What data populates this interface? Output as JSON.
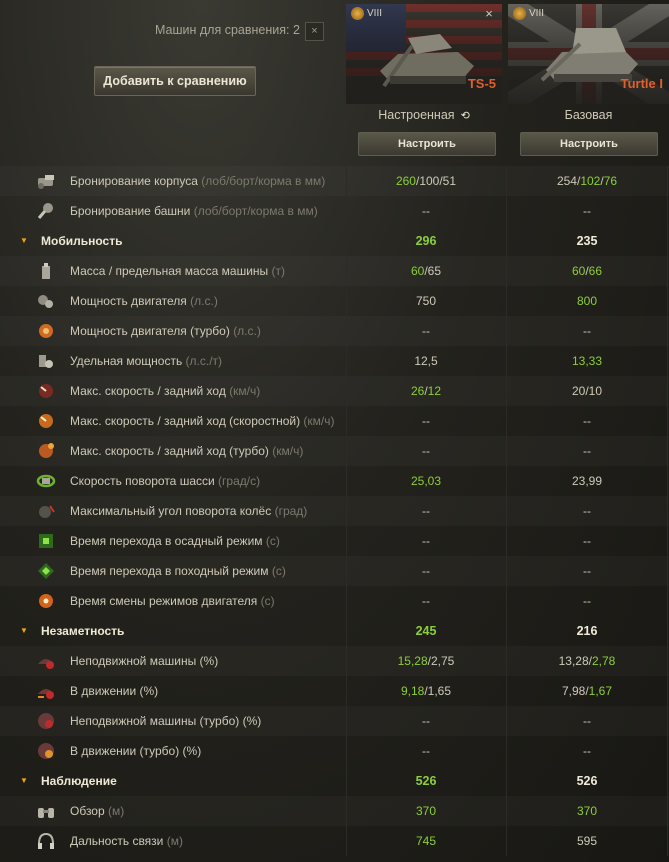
{
  "header": {
    "compare_label": "Машин для сравнения: 2",
    "close_symbol": "×",
    "add_button": "Добавить к сравнению"
  },
  "vehicles": [
    {
      "tier": "VIII",
      "name": "TS-5",
      "config": "Настроенная",
      "configure_button": "Настроить",
      "flag": "usa",
      "has_reset": true
    },
    {
      "tier": "VIII",
      "name": "Turtle I",
      "config": "Базовая",
      "configure_button": "Настроить",
      "flag": "uk",
      "has_reset": false
    }
  ],
  "accent_colors": {
    "green": "#8bcf3a",
    "orange": "#f0a21a",
    "name_red": "#e25f2b"
  },
  "rows": [
    {
      "type": "stat",
      "icon": "hull-armor-icon",
      "label": "Бронирование корпуса",
      "unit": "(лоб/борт/корма в мм)",
      "v1": [
        {
          "t": "260",
          "g": true
        },
        {
          "t": "/100/51",
          "g": false
        }
      ],
      "v2": [
        {
          "t": "254/",
          "g": false
        },
        {
          "t": "102",
          "g": true
        },
        {
          "t": "/",
          "g": false
        },
        {
          "t": "76",
          "g": true
        }
      ]
    },
    {
      "type": "stat",
      "icon": "turret-armor-icon",
      "label": "Бронирование башни",
      "unit": "(лоб/борт/корма в мм)",
      "v1": [
        {
          "t": "--",
          "g": false
        }
      ],
      "v2": [
        {
          "t": "--",
          "g": false
        }
      ]
    },
    {
      "type": "group",
      "label": "Мобильность",
      "v1": "296",
      "v2": "235"
    },
    {
      "type": "stat",
      "icon": "weight-icon",
      "label": "Масса / предельная масса машины",
      "unit": "(т)",
      "v1": [
        {
          "t": "60",
          "g": true
        },
        {
          "t": "/65",
          "g": false
        }
      ],
      "v2": [
        {
          "t": "60",
          "g": true
        },
        {
          "t": "/",
          "g": false
        },
        {
          "t": "66",
          "g": true
        }
      ]
    },
    {
      "type": "stat",
      "icon": "engine-icon",
      "label": "Мощность двигателя",
      "unit": "(л.с.)",
      "v1": [
        {
          "t": "750",
          "g": false
        }
      ],
      "v2": [
        {
          "t": "800",
          "g": true
        }
      ]
    },
    {
      "type": "stat",
      "icon": "engine-turbo-icon",
      "label": "Мощность двигателя (турбо)",
      "unit": "(л.с.)",
      "v1": [
        {
          "t": "--",
          "g": false
        }
      ],
      "v2": [
        {
          "t": "--",
          "g": false
        }
      ]
    },
    {
      "type": "stat",
      "icon": "specific-power-icon",
      "label": "Удельная мощность",
      "unit": "(л.с./т)",
      "v1": [
        {
          "t": "12,5",
          "g": false
        }
      ],
      "v2": [
        {
          "t": "13,33",
          "g": true
        }
      ]
    },
    {
      "type": "stat",
      "icon": "speed-icon",
      "label": "Макс. скорость / задний ход",
      "unit": "(км/ч)",
      "v1": [
        {
          "t": "26",
          "g": true
        },
        {
          "t": "/",
          "g": false
        },
        {
          "t": "12",
          "g": true
        }
      ],
      "v2": [
        {
          "t": "20/10",
          "g": false
        }
      ]
    },
    {
      "type": "stat",
      "icon": "speed-fast-icon",
      "label": "Макс. скорость / задний ход (скоростной)",
      "unit": "(км/ч)",
      "v1": [
        {
          "t": "--",
          "g": false
        }
      ],
      "v2": [
        {
          "t": "--",
          "g": false
        }
      ]
    },
    {
      "type": "stat",
      "icon": "speed-turbo-icon",
      "label": "Макс. скорость / задний ход (турбо)",
      "unit": "(км/ч)",
      "v1": [
        {
          "t": "--",
          "g": false
        }
      ],
      "v2": [
        {
          "t": "--",
          "g": false
        }
      ]
    },
    {
      "type": "stat",
      "icon": "traverse-icon",
      "label": "Скорость поворота шасси",
      "unit": "(град/с)",
      "v1": [
        {
          "t": "25,03",
          "g": true
        }
      ],
      "v2": [
        {
          "t": "23,99",
          "g": false
        }
      ]
    },
    {
      "type": "stat",
      "icon": "wheel-angle-icon",
      "label": "Максимальный угол поворота колёс",
      "unit": "(град)",
      "v1": [
        {
          "t": "--",
          "g": false
        }
      ],
      "v2": [
        {
          "t": "--",
          "g": false
        }
      ]
    },
    {
      "type": "stat",
      "icon": "siege-mode-icon",
      "label": "Время перехода в осадный режим",
      "unit": " (с)",
      "v1": [
        {
          "t": "--",
          "g": false
        }
      ],
      "v2": [
        {
          "t": "--",
          "g": false
        }
      ]
    },
    {
      "type": "stat",
      "icon": "travel-mode-icon",
      "label": "Время перехода в походный режим",
      "unit": " (с)",
      "v1": [
        {
          "t": "--",
          "g": false
        }
      ],
      "v2": [
        {
          "t": "--",
          "g": false
        }
      ]
    },
    {
      "type": "stat",
      "icon": "engine-mode-icon",
      "label": "Время смены режимов двигателя",
      "unit": "(с)",
      "v1": [
        {
          "t": "--",
          "g": false
        }
      ],
      "v2": [
        {
          "t": "--",
          "g": false
        }
      ]
    },
    {
      "type": "group",
      "label": "Незаметность",
      "v1": "245",
      "v2": "216"
    },
    {
      "type": "stat",
      "icon": "stationary-camo-icon",
      "label": "Неподвижной машины",
      "unit": "(%)",
      "unit_white": true,
      "v1": [
        {
          "t": "15,28",
          "g": true
        },
        {
          "t": "/2,75",
          "g": false
        }
      ],
      "v2": [
        {
          "t": "13,28/",
          "g": false
        },
        {
          "t": "2,78",
          "g": true
        }
      ]
    },
    {
      "type": "stat",
      "icon": "moving-camo-icon",
      "label": "В движении",
      "unit": "(%)",
      "unit_white": true,
      "v1": [
        {
          "t": "9,18",
          "g": true
        },
        {
          "t": "/1,65",
          "g": false
        }
      ],
      "v2": [
        {
          "t": "7,98/",
          "g": false
        },
        {
          "t": "1,67",
          "g": true
        }
      ]
    },
    {
      "type": "stat",
      "icon": "stationary-camo-turbo-icon",
      "label": "Неподвижной машины (турбо)",
      "unit": "(%)",
      "unit_white": true,
      "v1": [
        {
          "t": "--",
          "g": false
        }
      ],
      "v2": [
        {
          "t": "--",
          "g": false
        }
      ]
    },
    {
      "type": "stat",
      "icon": "moving-camo-turbo-icon",
      "label": "В движении (турбо)",
      "unit": "(%)",
      "unit_white": true,
      "v1": [
        {
          "t": "--",
          "g": false
        }
      ],
      "v2": [
        {
          "t": "--",
          "g": false
        }
      ]
    },
    {
      "type": "group",
      "label": "Наблюдение",
      "v1": "526",
      "v2": "526"
    },
    {
      "type": "stat",
      "icon": "binoculars-icon",
      "label": "Обзор",
      "unit": "(м)",
      "v1": [
        {
          "t": "370",
          "g": true
        }
      ],
      "v2": [
        {
          "t": "370",
          "g": true
        }
      ]
    },
    {
      "type": "stat",
      "icon": "radio-headset-icon",
      "label": "Дальность связи",
      "unit": "(м)",
      "v1": [
        {
          "t": "745",
          "g": true
        }
      ],
      "v2": [
        {
          "t": "595",
          "g": false
        }
      ]
    }
  ]
}
